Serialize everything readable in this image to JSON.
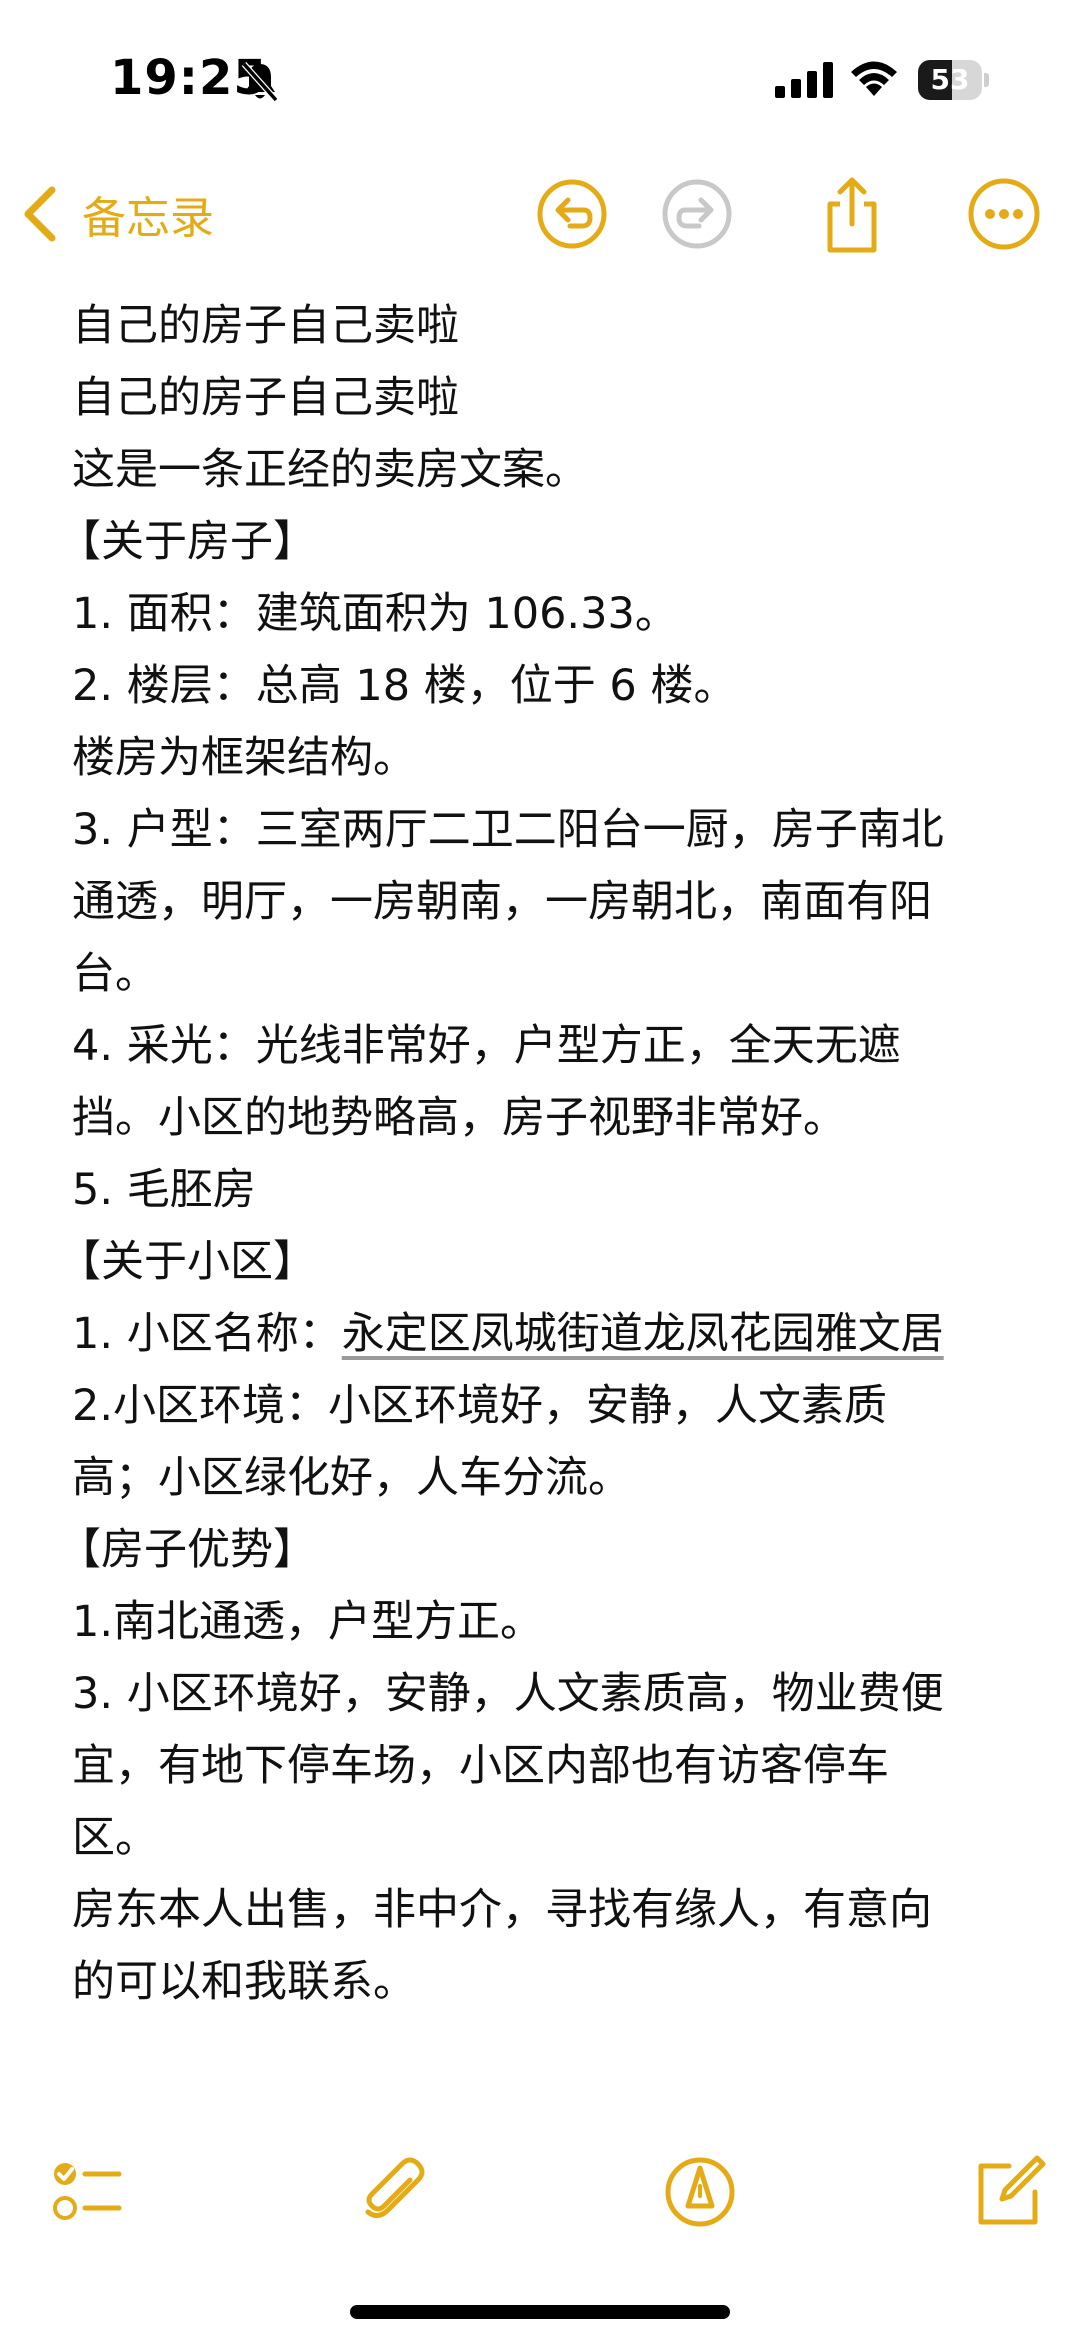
{
  "status_bar": {
    "time": "19:25",
    "battery_level": "53",
    "battery_fraction": 0.53
  },
  "nav": {
    "back_label": "备忘录",
    "icons": [
      "chevron-left-icon",
      "undo-icon",
      "redo-icon",
      "share-icon",
      "more-icon"
    ]
  },
  "note": {
    "lines": [
      "自己的房子自己卖啦",
      "自己的房子自己卖啦",
      "这是一条正经的卖房文案。",
      "【关于房子】",
      "1. 面积：建筑面积为 106.33。",
      "2. 楼层：总高 18 楼，位于 6 楼。",
      "楼房为框架结构。",
      "3. 户型：三室两厅二卫二阳台一厨，房子南北",
      "通透，明厅，一房朝南，一房朝北，南面有阳",
      "台。",
      "4. 采光：光线非常好，户型方正，全天无遮",
      "挡。小区的地势略高，房子视野非常好。",
      "5. 毛胚房",
      "【关于小区】",
      "1. 小区名称：",
      "2.小区环境：小区环境好，安静，人文素质",
      "高；小区绿化好，人车分流。",
      "【房子优势】",
      "1.南北通透，户型方正。",
      "3. 小区环境好，安静，人文素质高，物业费便",
      "宜，有地下停车场，小区内部也有访客停车",
      "区。",
      "房东本人出售，非中介，寻找有缘人，有意向",
      "的可以和我联系。"
    ],
    "address_link": "永定区凤城街道龙凤花园雅文居"
  },
  "toolbar": {
    "icons": [
      "checklist-icon",
      "paperclip-icon",
      "markup-pen-icon",
      "compose-icon"
    ]
  },
  "colors": {
    "accent": "#E4AB16",
    "text": "#111111",
    "disabled": "#C8C8C8"
  }
}
